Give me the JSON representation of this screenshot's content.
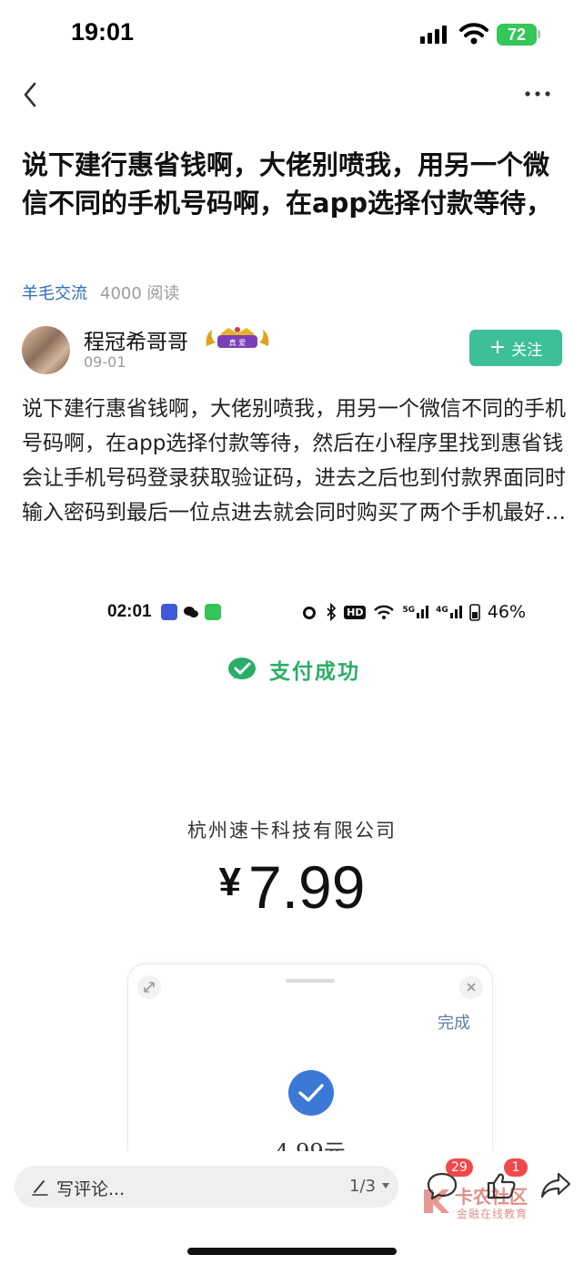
{
  "status_bar": {
    "time": "19:01",
    "battery": "72"
  },
  "post": {
    "title": "说下建行惠省钱啊，大佬别喷我，用另一个微信不同的手机号码啊，在app选择付款等待，",
    "category": "羊毛交流",
    "read_count": "4000 阅读",
    "author": {
      "name": "程冠希哥哥",
      "badge_text": "真 爱",
      "date": "09-01"
    },
    "follow_label": "关注",
    "body": "说下建行惠省钱啊，大佬别喷我，用另一个微信不同的手机号码啊，在app选择付款等待，然后在小程序里找到惠省钱会让手机号码登录获取验证码，进去之后也到付款界面同时输入密码到最后一位点进去就会同时购买了两个手机最好…"
  },
  "screenshot": {
    "status_time": "02:01",
    "status_right": "46%",
    "network": {
      "hd": "HD",
      "g5": "5G",
      "g4": "4G"
    },
    "success_text": "支付成功",
    "merchant": "杭州速卡科技有限公司",
    "currency": "¥",
    "amount": "7.99",
    "sheet": {
      "done_label": "完成",
      "amount": "4.99元"
    }
  },
  "bottom_bar": {
    "comment_placeholder": "写评论...",
    "page_indicator": "1/3",
    "comment_count": "29",
    "like_count": "1"
  },
  "watermark": {
    "title": "卡农社区",
    "subtitle": "金融在线教育"
  },
  "colors": {
    "accent": "#3dbf9a",
    "link": "#2d6db5",
    "badge": "#f0494b",
    "wechat_green": "#2aae67",
    "check_blue": "#3b79d6"
  }
}
